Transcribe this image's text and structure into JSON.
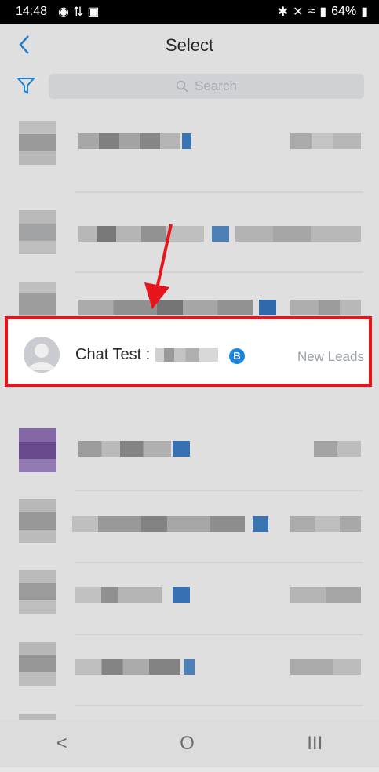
{
  "status_bar": {
    "time": "14:48",
    "battery": "64%"
  },
  "header": {
    "title": "Select"
  },
  "search": {
    "placeholder": "Search"
  },
  "highlighted_contact": {
    "name": "Chat Test :",
    "badge": "B",
    "tag": "New Leads"
  },
  "colors": {
    "highlight_border": "#e8141c",
    "accent": "#1a86e2"
  },
  "navbar": {
    "back": "<",
    "home": "O",
    "recents": "III"
  }
}
